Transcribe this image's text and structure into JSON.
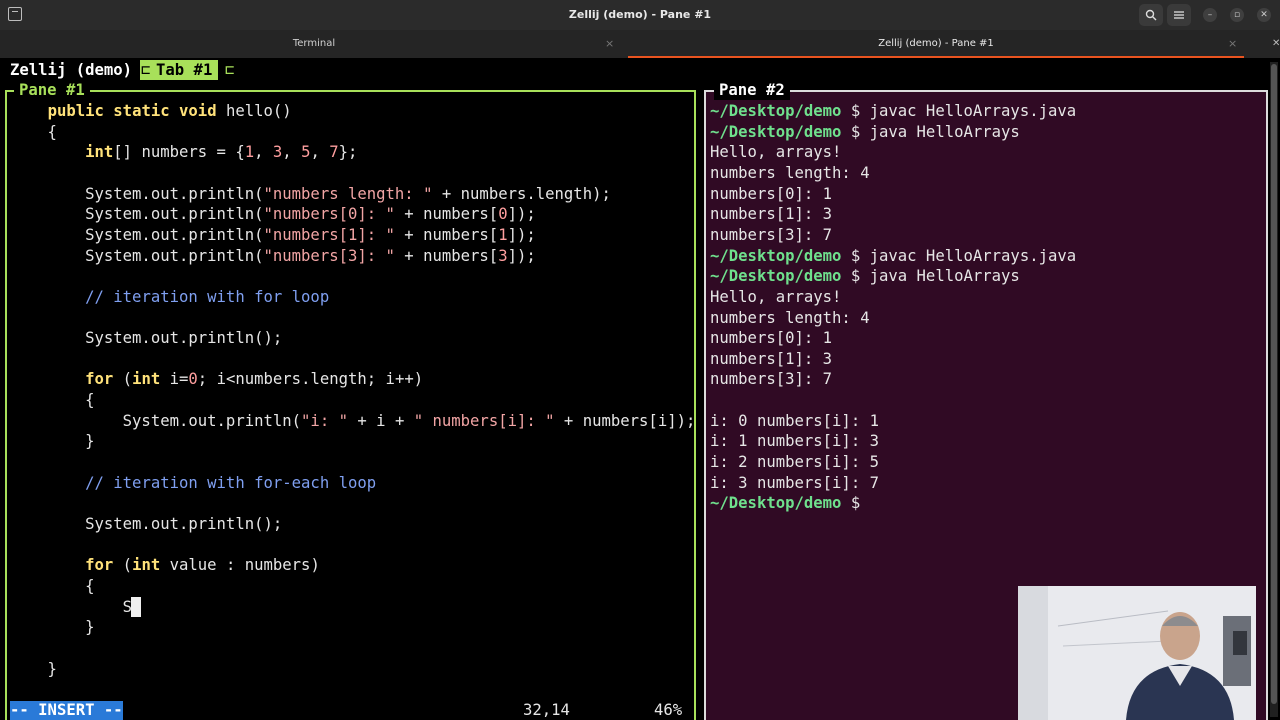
{
  "window": {
    "title": "Zellij (demo) - Pane #1",
    "search_icon": "search-icon",
    "menu_icon": "hamburger-menu-icon",
    "minimize": "–",
    "maximize": "▫",
    "close": "✕"
  },
  "tabs": [
    {
      "label": "Terminal",
      "close": "×"
    },
    {
      "label": "Zellij (demo) - Pane #1",
      "close": "×"
    }
  ],
  "zellij": {
    "session": "Zellij (demo)",
    "tab_glyph": "⊏",
    "tab_label": "Tab #1",
    "tab_glyph_right": "⊏"
  },
  "pane1": {
    "title": "Pane #1",
    "lines": [
      [
        {
          "t": "    "
        },
        {
          "t": "public",
          "c": "k"
        },
        {
          "t": " "
        },
        {
          "t": "static",
          "c": "k"
        },
        {
          "t": " "
        },
        {
          "t": "void",
          "c": "k"
        },
        {
          "t": " hello()"
        }
      ],
      [
        {
          "t": "    {"
        }
      ],
      [
        {
          "t": "        "
        },
        {
          "t": "int",
          "c": "k"
        },
        {
          "t": "[] numbers = {"
        },
        {
          "t": "1",
          "c": "n"
        },
        {
          "t": ", "
        },
        {
          "t": "3",
          "c": "n"
        },
        {
          "t": ", "
        },
        {
          "t": "5",
          "c": "n"
        },
        {
          "t": ", "
        },
        {
          "t": "7",
          "c": "n"
        },
        {
          "t": "};"
        }
      ],
      [
        {
          "t": ""
        }
      ],
      [
        {
          "t": "        System.out.println("
        },
        {
          "t": "\"numbers length: \"",
          "c": "s"
        },
        {
          "t": " + numbers.length);"
        }
      ],
      [
        {
          "t": "        System.out.println("
        },
        {
          "t": "\"numbers[0]: \"",
          "c": "s"
        },
        {
          "t": " + numbers["
        },
        {
          "t": "0",
          "c": "n"
        },
        {
          "t": "]);"
        }
      ],
      [
        {
          "t": "        System.out.println("
        },
        {
          "t": "\"numbers[1]: \"",
          "c": "s"
        },
        {
          "t": " + numbers["
        },
        {
          "t": "1",
          "c": "n"
        },
        {
          "t": "]);"
        }
      ],
      [
        {
          "t": "        System.out.println("
        },
        {
          "t": "\"numbers[3]: \"",
          "c": "s"
        },
        {
          "t": " + numbers["
        },
        {
          "t": "3",
          "c": "n"
        },
        {
          "t": "]);"
        }
      ],
      [
        {
          "t": ""
        }
      ],
      [
        {
          "t": "        "
        },
        {
          "t": "// iteration with for loop",
          "c": "c"
        }
      ],
      [
        {
          "t": ""
        }
      ],
      [
        {
          "t": "        System.out.println();"
        }
      ],
      [
        {
          "t": ""
        }
      ],
      [
        {
          "t": "        "
        },
        {
          "t": "for",
          "c": "k"
        },
        {
          "t": " ("
        },
        {
          "t": "int",
          "c": "k"
        },
        {
          "t": " i="
        },
        {
          "t": "0",
          "c": "n"
        },
        {
          "t": "; i<numbers.length; i++)"
        }
      ],
      [
        {
          "t": "        {"
        }
      ],
      [
        {
          "t": "            System.out.println("
        },
        {
          "t": "\"i: \"",
          "c": "s"
        },
        {
          "t": " + i + "
        },
        {
          "t": "\" numbers[i]: \"",
          "c": "s"
        },
        {
          "t": " + numbers[i]);"
        }
      ],
      [
        {
          "t": "        }"
        }
      ],
      [
        {
          "t": ""
        }
      ],
      [
        {
          "t": "        "
        },
        {
          "t": "// iteration with for-each loop",
          "c": "c"
        }
      ],
      [
        {
          "t": ""
        }
      ],
      [
        {
          "t": "        System.out.println();"
        }
      ],
      [
        {
          "t": ""
        }
      ],
      [
        {
          "t": "        "
        },
        {
          "t": "for",
          "c": "k"
        },
        {
          "t": " ("
        },
        {
          "t": "int",
          "c": "k"
        },
        {
          "t": " value : numbers)"
        }
      ],
      [
        {
          "t": "        {"
        }
      ],
      [
        {
          "t": "            S"
        }
      ],
      [
        {
          "t": "        }"
        }
      ],
      [
        {
          "t": ""
        }
      ],
      [
        {
          "t": "    }"
        }
      ]
    ]
  },
  "pane2": {
    "title": "Pane #2",
    "lines": [
      [
        {
          "t": "~/Desktop/demo",
          "c": "p"
        },
        {
          "t": " $ javac HelloArrays.java"
        }
      ],
      [
        {
          "t": "~/Desktop/demo",
          "c": "p"
        },
        {
          "t": " $ java HelloArrays"
        }
      ],
      [
        {
          "t": "Hello, arrays!"
        }
      ],
      [
        {
          "t": "numbers length: 4"
        }
      ],
      [
        {
          "t": "numbers[0]: 1"
        }
      ],
      [
        {
          "t": "numbers[1]: 3"
        }
      ],
      [
        {
          "t": "numbers[3]: 7"
        }
      ],
      [
        {
          "t": "~/Desktop/demo",
          "c": "p"
        },
        {
          "t": " $ javac HelloArrays.java"
        }
      ],
      [
        {
          "t": "~/Desktop/demo",
          "c": "p"
        },
        {
          "t": " $ java HelloArrays"
        }
      ],
      [
        {
          "t": "Hello, arrays!"
        }
      ],
      [
        {
          "t": "numbers length: 4"
        }
      ],
      [
        {
          "t": "numbers[0]: 1"
        }
      ],
      [
        {
          "t": "numbers[1]: 3"
        }
      ],
      [
        {
          "t": "numbers[3]: 7"
        }
      ],
      [
        {
          "t": ""
        }
      ],
      [
        {
          "t": "i: 0 numbers[i]: 1"
        }
      ],
      [
        {
          "t": "i: 1 numbers[i]: 3"
        }
      ],
      [
        {
          "t": "i: 2 numbers[i]: 5"
        }
      ],
      [
        {
          "t": "i: 3 numbers[i]: 7"
        }
      ],
      [
        {
          "t": "~/Desktop/demo",
          "c": "p"
        },
        {
          "t": " $"
        }
      ]
    ]
  },
  "vim": {
    "mode": "-- INSERT --",
    "position": "32,14",
    "percent": "46%"
  },
  "colors": {
    "accent_green": "#a8e05a",
    "terminal_bg": "#300a24",
    "insert_blue": "#2a7ad8",
    "tab_underline": "#e95420"
  }
}
